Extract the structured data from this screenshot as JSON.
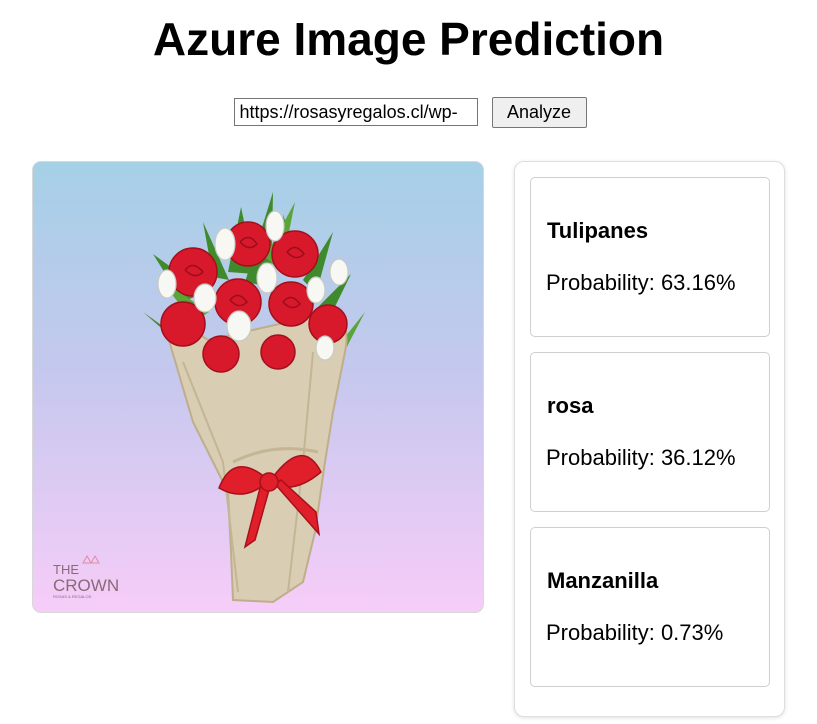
{
  "page": {
    "title": "Azure Image Prediction"
  },
  "form": {
    "url_value": "https://rosasyregalos.cl/wp-",
    "analyze_label": "Analyze"
  },
  "image": {
    "logo_text_top": "THE",
    "logo_text_main": "CROWN",
    "logo_text_sub": "ROSAS & REGALOS"
  },
  "predictions": [
    {
      "tag": "Tulipanes",
      "probability_text": "Probability: 63.16%",
      "probability": 63.16
    },
    {
      "tag": "rosa",
      "probability_text": "Probability: 36.12%",
      "probability": 36.12
    },
    {
      "tag": "Manzanilla",
      "probability_text": "Probability: 0.73%",
      "probability": 0.73
    }
  ],
  "colors": {
    "background_top": "#a5d0e6",
    "background_bottom": "#f6cdf8",
    "rose": "#d8192c",
    "ribbon": "#e01f2a",
    "burlap": "#d9cdb3"
  }
}
